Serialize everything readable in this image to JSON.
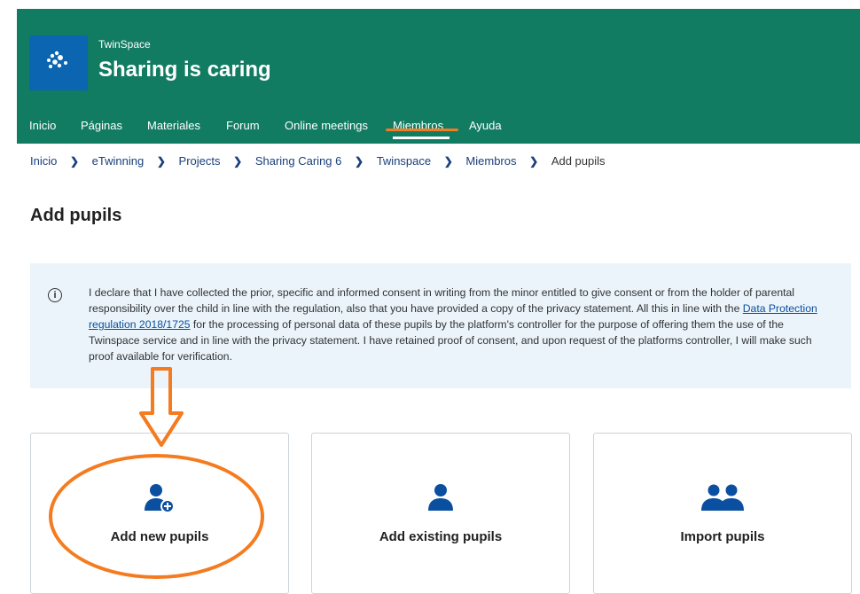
{
  "header": {
    "space_label": "TwinSpace",
    "space_title": "Sharing is caring",
    "nav": [
      {
        "label": "Inicio"
      },
      {
        "label": "Páginas"
      },
      {
        "label": "Materiales"
      },
      {
        "label": "Forum"
      },
      {
        "label": "Online meetings"
      },
      {
        "label": "Miembros",
        "active": true
      },
      {
        "label": "Ayuda"
      }
    ],
    "colors": {
      "bar": "#127c63",
      "logo": "#0b65b0"
    }
  },
  "breadcrumb": [
    "Inicio",
    "eTwinning",
    "Projects",
    "Sharing Caring 6",
    "Twinspace",
    "Miembros",
    "Add pupils"
  ],
  "page_title": "Add pupils",
  "info": {
    "icon": "info-circle-icon",
    "text_before": "I declare that I have collected the prior, specific and informed consent in writing from the minor entitled to give consent or from the holder of parental responsibility over the child in line with the regulation, also that you have provided a copy of the privacy statement. All this in line with the ",
    "link": "Data Protection regulation 2018/1725",
    "text_after": " for the processing of personal data of these pupils by the platform's controller for the purpose of offering them the use of the Twinspace service and in line with the privacy statement. I have retained proof of consent, and upon request of the platforms controller, I will make such proof available for verification."
  },
  "cards": [
    {
      "label": "Add new pupils",
      "icon": "user-plus-icon"
    },
    {
      "label": "Add existing pupils",
      "icon": "user-icon"
    },
    {
      "label": "Import pupils",
      "icon": "users-icon"
    }
  ],
  "accent_color": "#0b4fa0",
  "annotation_color": "#f47b20"
}
